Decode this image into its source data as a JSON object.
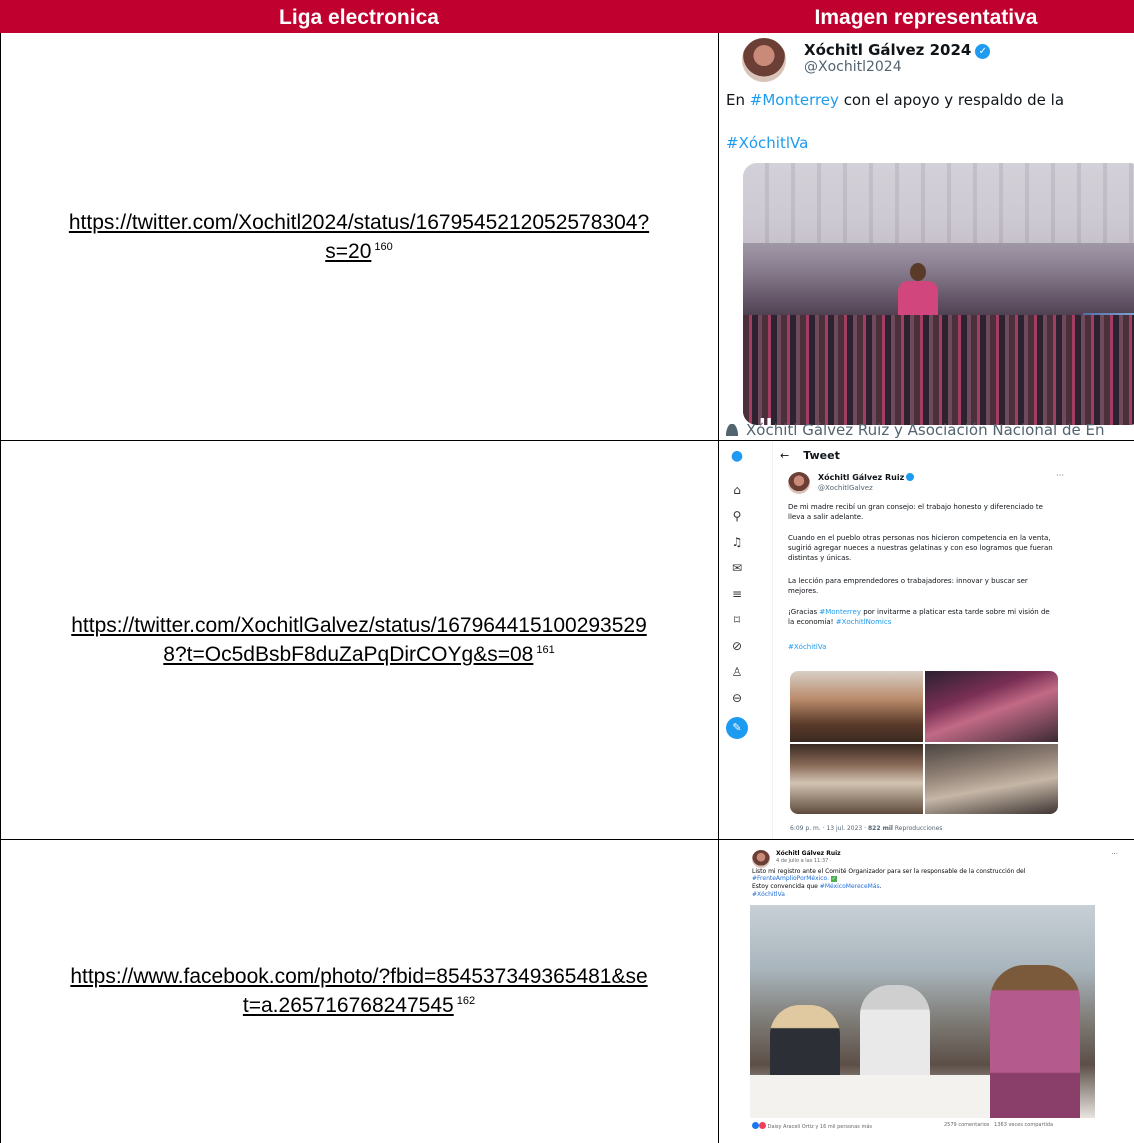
{
  "table": {
    "header_col1": "Liga electronica",
    "header_col2": "Imagen representativa",
    "colors": {
      "header_bg": "#c0002e",
      "header_text": "#ffffff",
      "border": "#000000",
      "link": "#000000"
    }
  },
  "rows": [
    {
      "link_line1": "https://twitter.com/Xochitl2024/status/1679545212052578304?",
      "link_line2": "s=20",
      "footnote": "160",
      "image": {
        "name": "Xóchitl Gálvez 2024",
        "handle": "@Xochitl2024",
        "text_prefix": "En ",
        "hashtag": "#Monterrey",
        "text_suffix": " con el apoyo y respaldo de la",
        "hashtag2": "#XóchitlVa",
        "pause": "II",
        "caption": "Xóchitl Gálvez Ruiz y Asociación Nacional de En"
      }
    },
    {
      "link_line1": "https://twitter.com/XochitlGalvez/status/167964415100293529",
      "link_line2": "8?t=Oc5dBsbF8duZaPqDirCOYg&s=08",
      "footnote": "161",
      "image": {
        "back": "←",
        "title": "Tweet",
        "name": "Xóchitl Gálvez Ruiz",
        "handle": "@XochitlGalvez",
        "more": "···",
        "p1": "De mi madre recibí un gran consejo: el trabajo honesto y diferenciado te lleva a salir adelante.",
        "p2": "Cuando en el pueblo otras personas nos hicieron competencia en la venta, sugirió agregar nueces a nuestras gelatinas y con eso logramos que fueran distintas y únicas.",
        "p3": "La lección para emprendedores o trabajadores: innovar y buscar ser mejores.",
        "p4_a": "¡Gracias ",
        "p4_tag": "#Monterrey",
        "p4_b": " por invitarme a platicar esta tarde sobre mi visión de la economía! ",
        "p4_tag2": "#XochitlNomics",
        "p5": "#XóchitlVa",
        "footer_time": "6:09 p. m. · 13 jul. 2023 · ",
        "footer_views": "822 mil",
        "footer_label": " Reproducciones",
        "sidebar_icons": [
          "twitter-bird-icon",
          "home-icon",
          "search-icon",
          "notifications-icon",
          "messages-icon",
          "lists-icon",
          "bookmarks-icon",
          "verified-icon",
          "profile-icon",
          "more-icon",
          "compose-icon"
        ]
      }
    },
    {
      "link_line1": "https://www.facebook.com/photo/?fbid=854537349365481&se",
      "link_line2": "t=a.265716768247545",
      "footnote": "162",
      "image": {
        "name": "Xóchitl Gálvez Ruiz",
        "date": "4 de julio a las 11:37 · ",
        "more": "···",
        "line1": "Listo mi registro ante el Comité Organizador para ser la responsable de la construcción del",
        "line2_tag": "#FrenteAmplioPorMéxico.",
        "line3_a": "Estoy convencida que ",
        "line3_tag": "#MéxicoMereceMás",
        "line3_b": ".",
        "line4_tag": "#XóchitlVa",
        "reactions": "Daisy Araceli Ortiz y 16 mil personas más",
        "comments": "2579 comentarios",
        "shares": "1363 veces compartida"
      }
    }
  ]
}
